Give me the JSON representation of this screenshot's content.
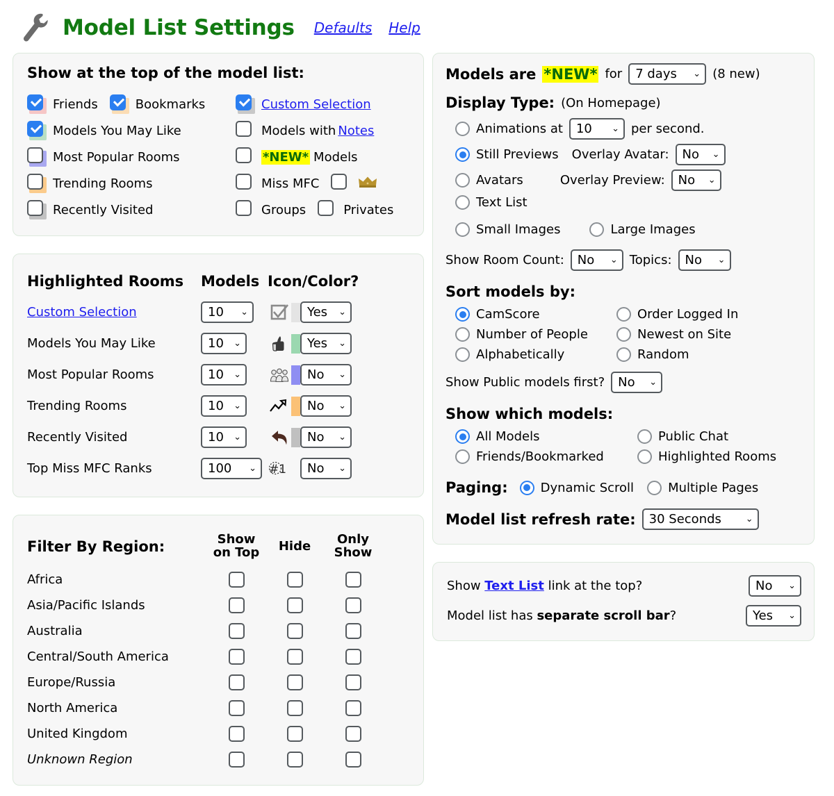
{
  "header": {
    "title": "Model List Settings",
    "icon": "wrench-icon",
    "links": [
      "Defaults",
      "Help"
    ]
  },
  "colors": {
    "title_green": "#127a12",
    "link_blue": "#2020ee",
    "checked_blue": "#2a7ef0",
    "new_highlight": "#ffff00",
    "new_text": "#0a6b0a",
    "panel_bg": "#f7f7f7",
    "panel_border": "#dce9dc"
  },
  "show_at_top": {
    "heading": "Show at the top of the model list:",
    "column_a": [
      {
        "label": "Friends",
        "checked": true,
        "backing": "#f6c6c6"
      },
      {
        "label": "Bookmarks",
        "checked": true,
        "backing": "#fbdcb4"
      },
      {
        "label": "Models You May Like",
        "checked": true,
        "backing": "#b9dfc4"
      },
      {
        "label": "Most Popular Rooms",
        "checked": false,
        "backing": "#a9a8f0"
      },
      {
        "label": "Trending Rooms",
        "checked": false,
        "backing": "#fbcb8c"
      },
      {
        "label": "Recently Visited",
        "checked": false,
        "backing": "#c2c2c2"
      }
    ],
    "column_b": [
      {
        "label": "Custom Selection",
        "checked": true,
        "backing": "#c8c8c8",
        "link": true
      },
      {
        "label_pre": "Models with ",
        "link_text": "Notes",
        "checked": false
      },
      {
        "new_tag": "*NEW*",
        "label_post": " Models",
        "checked": false
      },
      {
        "label": "Miss MFC",
        "checked": false,
        "extra_checkbox": true,
        "icon": "crown-icon"
      },
      {
        "label": "Groups",
        "checked": false,
        "second_label": "Privates",
        "second_checked": false
      }
    ]
  },
  "highlighted_rooms": {
    "headers": [
      "Highlighted Rooms",
      "Models",
      "Icon/Color?"
    ],
    "rows": [
      {
        "name": "Custom Selection",
        "link": true,
        "models": "10",
        "icon": "checkbox-check-icon",
        "swatch": "#e4e4e4",
        "color": "Yes"
      },
      {
        "name": "Models You May Like",
        "link": false,
        "models": "10",
        "icon": "thumbs-up-icon",
        "swatch": "#9bd8b0",
        "color": "Yes"
      },
      {
        "name": "Most Popular Rooms",
        "link": false,
        "models": "10",
        "icon": "crowd-icon",
        "swatch": "#8f8ef2",
        "color": "No"
      },
      {
        "name": "Trending Rooms",
        "link": false,
        "models": "10",
        "icon": "trending-up-icon",
        "swatch": "#fbc176",
        "color": "No"
      },
      {
        "name": "Recently Visited",
        "link": false,
        "models": "10",
        "icon": "back-arrow-icon",
        "swatch": "#c0c0c0",
        "color": "No"
      },
      {
        "name": "Top Miss MFC Ranks",
        "link": false,
        "models": "100",
        "icon": "rank-one-icon",
        "swatch": "",
        "color": "No"
      }
    ]
  },
  "filter_by_region": {
    "heading": "Filter By Region:",
    "columns": [
      "Show\non Top",
      "Hide",
      "Only\nShow"
    ],
    "column_labels": {
      "show_on_top": "Show on Top",
      "hide": "Hide",
      "only_show": "Only Show"
    },
    "rows": [
      {
        "name": "Africa",
        "italic": false,
        "show_on_top": false,
        "hide": false,
        "only_show": false
      },
      {
        "name": "Asia/Pacific Islands",
        "italic": false,
        "show_on_top": false,
        "hide": false,
        "only_show": false
      },
      {
        "name": "Australia",
        "italic": false,
        "show_on_top": false,
        "hide": false,
        "only_show": false
      },
      {
        "name": "Central/South America",
        "italic": false,
        "show_on_top": false,
        "hide": false,
        "only_show": false
      },
      {
        "name": "Europe/Russia",
        "italic": false,
        "show_on_top": false,
        "hide": false,
        "only_show": false
      },
      {
        "name": "North America",
        "italic": false,
        "show_on_top": false,
        "hide": false,
        "only_show": false
      },
      {
        "name": "United Kingdom",
        "italic": false,
        "show_on_top": false,
        "hide": false,
        "only_show": false
      },
      {
        "name": "Unknown Region",
        "italic": true,
        "show_on_top": false,
        "hide": false,
        "only_show": false
      }
    ]
  },
  "models_new": {
    "prefix": "Models are",
    "tag": "*NEW*",
    "mid": "for",
    "days_value": "7 days",
    "count": "(8 new)"
  },
  "display_type": {
    "heading": "Display Type:",
    "sub": "(On Homepage)",
    "options": [
      {
        "label": "Animations at",
        "selected": false,
        "rate": "10",
        "suffix": "per second."
      },
      {
        "label": "Still Previews",
        "selected": true
      },
      {
        "label": "Avatars",
        "selected": false
      },
      {
        "label": "Text List",
        "selected": false
      }
    ],
    "overlay_avatar_label": "Overlay Avatar:",
    "overlay_avatar_value": "No",
    "overlay_preview_label": "Overlay Preview:",
    "overlay_preview_value": "No",
    "size_options": [
      {
        "label": "Small Images",
        "selected": true
      },
      {
        "label": "Large Images",
        "selected": false
      }
    ],
    "room_count_label": "Show Room Count:",
    "room_count_value": "No",
    "topics_label": "Topics:",
    "topics_value": "No"
  },
  "sort_models": {
    "heading": "Sort models by:",
    "options": [
      {
        "label": "CamScore",
        "selected": true
      },
      {
        "label": "Order Logged In",
        "selected": false
      },
      {
        "label": "Number of People",
        "selected": false
      },
      {
        "label": "Newest on Site",
        "selected": false
      },
      {
        "label": "Alphabetically",
        "selected": false
      },
      {
        "label": "Random",
        "selected": false
      }
    ],
    "public_first_label": "Show Public models first?",
    "public_first_value": "No"
  },
  "show_which": {
    "heading": "Show which models:",
    "options": [
      {
        "label": "All Models",
        "selected": true
      },
      {
        "label": "Public Chat",
        "selected": false
      },
      {
        "label": "Friends/Bookmarked",
        "selected": false
      },
      {
        "label": "Highlighted Rooms",
        "selected": false
      }
    ],
    "paging_label": "Paging:",
    "paging_options": [
      {
        "label": "Dynamic Scroll",
        "selected": true
      },
      {
        "label": "Multiple Pages",
        "selected": false
      }
    ],
    "refresh_label": "Model list refresh rate:",
    "refresh_value": "30 Seconds"
  },
  "bottom_panel": {
    "row1_pre": "Show ",
    "row1_link": "Text List",
    "row1_post": " link at the top?",
    "row1_value": "No",
    "row2_pre": "Model list has ",
    "row2_bold": "separate scroll bar",
    "row2_post": "?",
    "row2_value": "Yes"
  }
}
